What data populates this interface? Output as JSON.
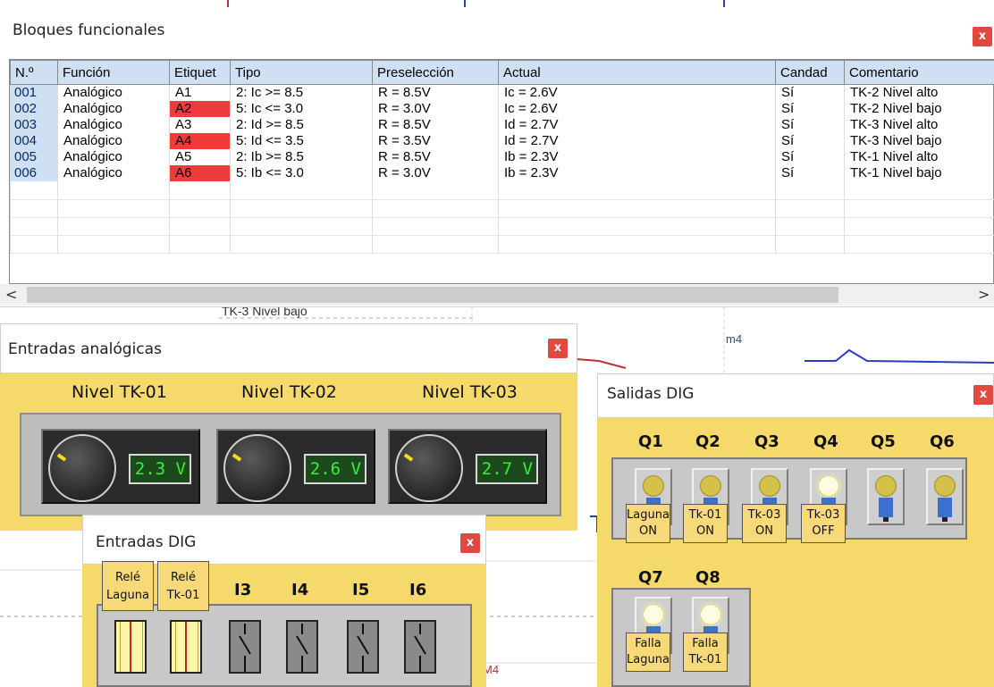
{
  "bloques": {
    "title": "Bloques funcionales",
    "close": "x",
    "columns": [
      "N.º",
      "Función",
      "Etiquet",
      "Tipo",
      "Preselección",
      "Actual",
      "Candad",
      "Comentario"
    ],
    "rows": [
      {
        "num": "001",
        "funcion": "Analógico",
        "etiqueta": "A1",
        "tipo": "2: Ic >= 8.5",
        "pre": "R = 8.5V",
        "actual": "Ic = 2.6V",
        "candado": "Sí",
        "comentario": "TK-2 Nivel alto",
        "highlight": false
      },
      {
        "num": "002",
        "funcion": "Analógico",
        "etiqueta": "A2",
        "tipo": "5: Ic <= 3.0",
        "pre": "R = 3.0V",
        "actual": "Ic = 2.6V",
        "candado": "Sí",
        "comentario": "TK-2 Nivel bajo",
        "highlight": true
      },
      {
        "num": "003",
        "funcion": "Analógico",
        "etiqueta": "A3",
        "tipo": "2: Id >= 8.5",
        "pre": "R = 8.5V",
        "actual": "Id = 2.7V",
        "candado": "Sí",
        "comentario": "TK-3 Nivel alto",
        "highlight": false
      },
      {
        "num": "004",
        "funcion": "Analógico",
        "etiqueta": "A4",
        "tipo": "5: Id <= 3.5",
        "pre": "R = 3.5V",
        "actual": "Id = 2.7V",
        "candado": "Sí",
        "comentario": "TK-3 Nivel bajo",
        "highlight": true
      },
      {
        "num": "005",
        "funcion": "Analógico",
        "etiqueta": "A5",
        "tipo": "2: Ib >= 8.5",
        "pre": "R = 8.5V",
        "actual": "Ib = 2.3V",
        "candado": "Sí",
        "comentario": "TK-1 Nivel alto",
        "highlight": false
      },
      {
        "num": "006",
        "funcion": "Analógico",
        "etiqueta": "A6",
        "tipo": "5: Ib <= 3.0",
        "pre": "R = 3.0V",
        "actual": "Ib = 2.3V",
        "candado": "Sí",
        "comentario": "TK-1 Nivel bajo",
        "highlight": true
      }
    ],
    "highlight_color": "#ef3b3b"
  },
  "background": {
    "caption": "TK-3 Nivel bajo",
    "m4_top": "m4",
    "m4_bottom": "M4"
  },
  "entradas_analogicas": {
    "title": "Entradas analógicas",
    "close": "x",
    "channels": [
      {
        "label": "Nivel TK-01",
        "value": "2.3 V"
      },
      {
        "label": "Nivel TK-02",
        "value": "2.6 V"
      },
      {
        "label": "Nivel TK-03",
        "value": "2.7 V"
      }
    ]
  },
  "salidas_dig": {
    "title": "Salidas DIG",
    "close": "x",
    "row1": [
      "Q1",
      "Q2",
      "Q3",
      "Q4",
      "Q5",
      "Q6"
    ],
    "row2": [
      "Q7",
      "Q8"
    ],
    "lamps_on": {
      "Q1": false,
      "Q2": false,
      "Q3": false,
      "Q4": true,
      "Q5": false,
      "Q6": false,
      "Q7": true,
      "Q8": true
    },
    "tags": {
      "Q1": [
        "Laguna",
        "ON"
      ],
      "Q2": [
        "Tk-01",
        "ON"
      ],
      "Q3": [
        "Tk-03",
        "ON"
      ],
      "Q4": [
        "Tk-03",
        "OFF"
      ],
      "Q7": [
        "Falla",
        "Laguna"
      ],
      "Q8": [
        "Falla",
        "Tk-01"
      ]
    }
  },
  "entradas_dig": {
    "title": "Entradas DIG",
    "close": "x",
    "inputs": [
      {
        "label_lines": [
          "Relé",
          "Laguna"
        ],
        "on": true
      },
      {
        "label_lines": [
          "Relé",
          "Tk-01"
        ],
        "on": true
      },
      {
        "label": "I3",
        "on": false
      },
      {
        "label": "I4",
        "on": false
      },
      {
        "label": "I5",
        "on": false
      },
      {
        "label": "I6",
        "on": false
      }
    ]
  }
}
